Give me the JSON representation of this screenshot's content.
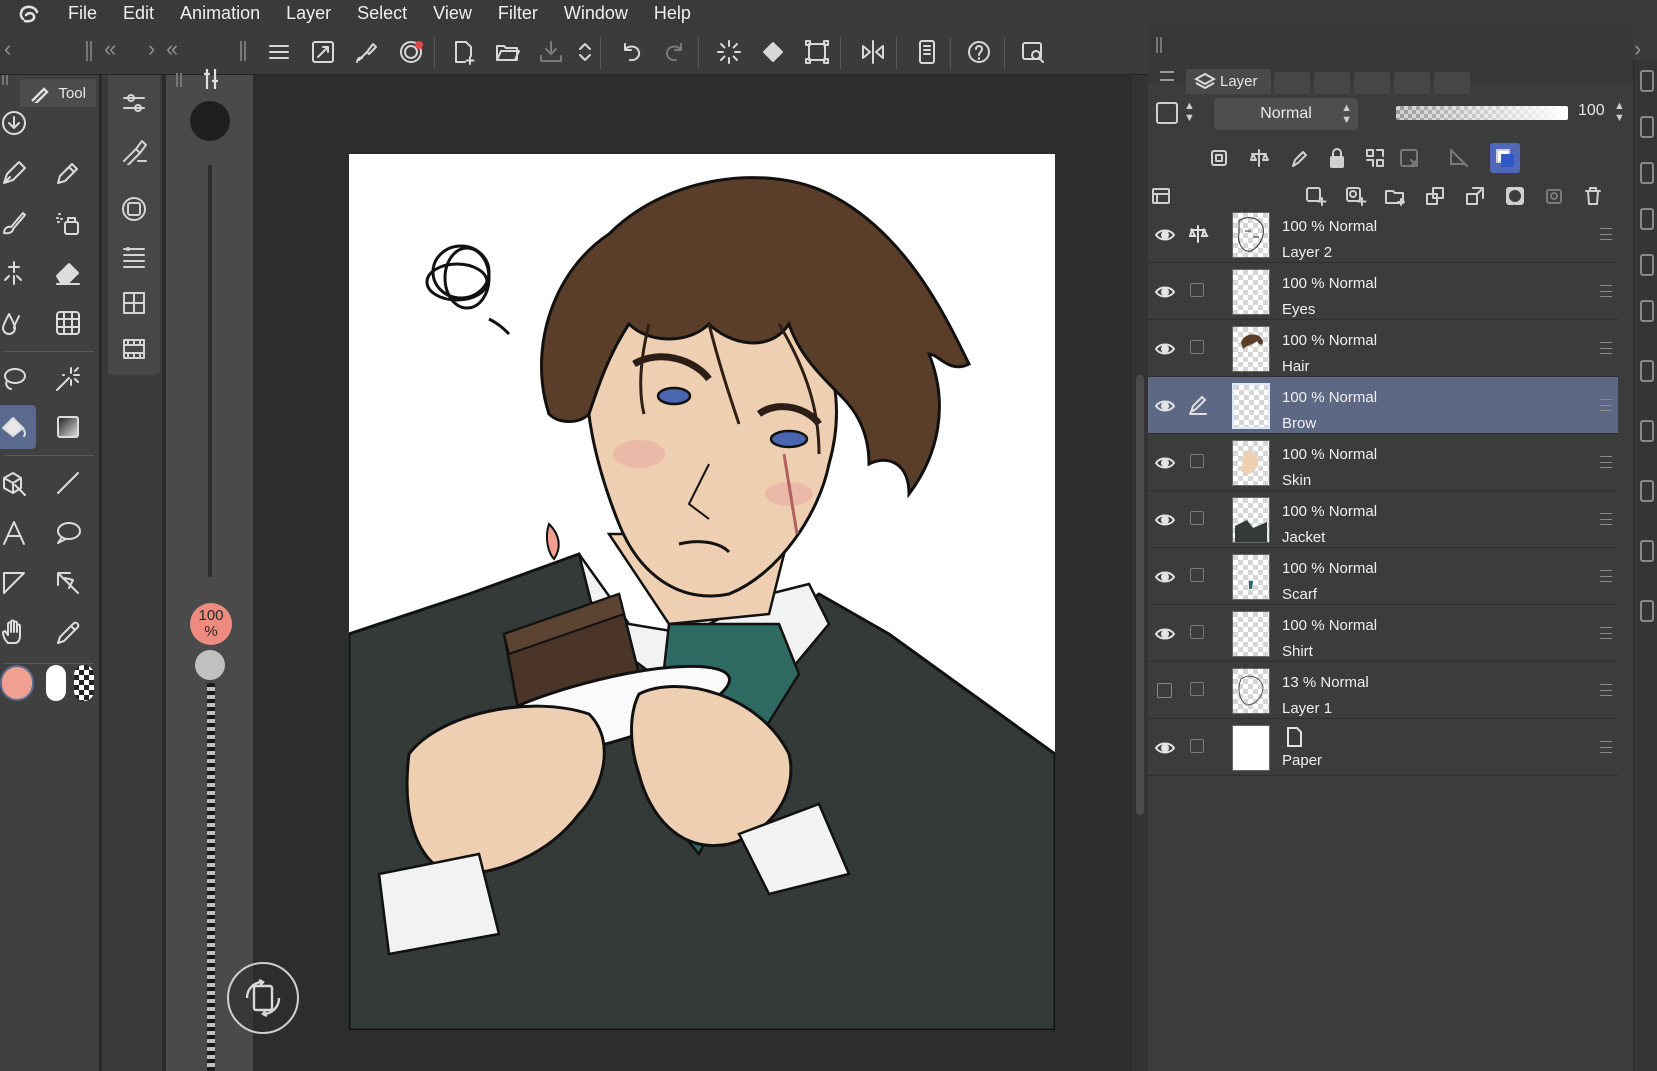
{
  "menubar": {
    "logo": "clip-studio-logo-icon",
    "items": [
      "File",
      "Edit",
      "Animation",
      "Layer",
      "Select",
      "View",
      "Filter",
      "Window",
      "Help"
    ]
  },
  "commandbar": {
    "icons": [
      "menu-icon",
      "fit-to-screen-icon",
      "edit-brush-icon",
      "onion-skin-icon",
      "new-file-icon",
      "open-icon",
      "save-icon",
      "arrange-icon",
      "undo-icon",
      "redo-icon",
      "loading-icon",
      "fill-icon",
      "transform-icon",
      "flip-horizontal-icon",
      "companion-icon",
      "help-icon",
      "quick-access-icon"
    ]
  },
  "tool_palette": {
    "tab_label": "Tool",
    "tools": [
      "pen-tool-icon",
      "pencil-tool-icon",
      "brush-tool-icon",
      "airbrush-tool-icon",
      "decoration-tool-icon",
      "eraser-tool-icon",
      "blend-tool-icon",
      "mesh-transform-icon",
      "lasso-select-icon",
      "auto-select-icon",
      "fill-tool-icon",
      "gradient-tool-icon",
      "object-select-icon",
      "line-tool-icon",
      "text-tool-icon",
      "balloon-tool-icon",
      "frame-border-icon",
      "ruler-tool-icon",
      "hand-tool-icon",
      "eyedropper-tool-icon"
    ],
    "active_tool": "fill-tool-icon"
  },
  "brush_size": {
    "opacity_label_top": "100",
    "opacity_label_bottom": "%"
  },
  "colors": {
    "main": "#f0a090",
    "sub": "#ffffff",
    "accent": "#5d6885"
  },
  "layer_panel": {
    "tab_label": "Layer",
    "blend_mode": "Normal",
    "opacity": "100",
    "layers": [
      {
        "percent": "100 %",
        "mode": "Normal",
        "name": "Layer 2",
        "visible": true,
        "reference": true,
        "selected": false
      },
      {
        "percent": "100 %",
        "mode": "Normal",
        "name": "Eyes",
        "visible": true,
        "reference": false,
        "selected": false
      },
      {
        "percent": "100 %",
        "mode": "Normal",
        "name": "Hair",
        "visible": true,
        "reference": false,
        "selected": false
      },
      {
        "percent": "100 %",
        "mode": "Normal",
        "name": "Brow",
        "visible": true,
        "reference": false,
        "selected": true
      },
      {
        "percent": "100 %",
        "mode": "Normal",
        "name": "Skin",
        "visible": true,
        "reference": false,
        "selected": false
      },
      {
        "percent": "100 %",
        "mode": "Normal",
        "name": "Jacket",
        "visible": true,
        "reference": false,
        "selected": false
      },
      {
        "percent": "100 %",
        "mode": "Normal",
        "name": "Scarf",
        "visible": true,
        "reference": false,
        "selected": false
      },
      {
        "percent": "100 %",
        "mode": "Normal",
        "name": "Shirt",
        "visible": true,
        "reference": false,
        "selected": false
      },
      {
        "percent": "13 %",
        "mode": "Normal",
        "name": "Layer 1",
        "visible": false,
        "reference": false,
        "selected": false
      },
      {
        "percent": "",
        "mode": "",
        "name": "Paper",
        "visible": true,
        "reference": false,
        "selected": false
      }
    ]
  }
}
